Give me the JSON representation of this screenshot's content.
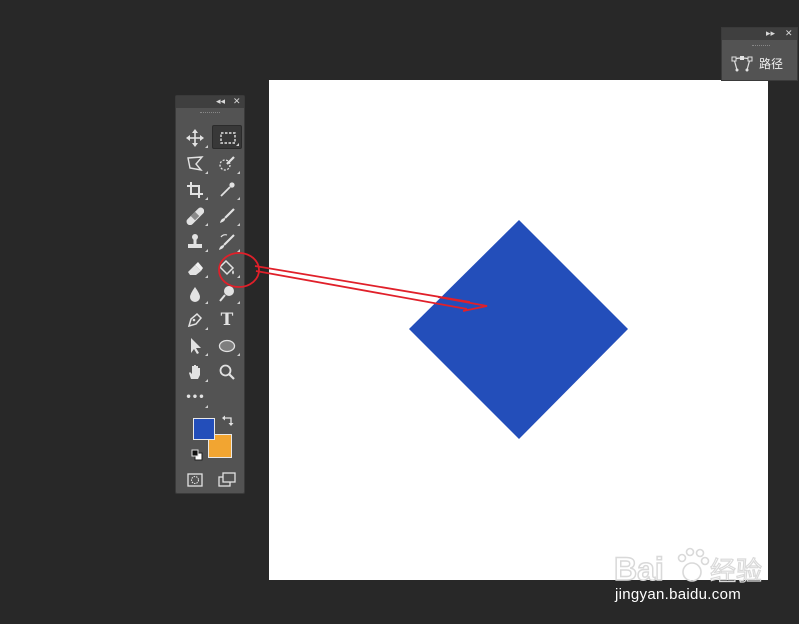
{
  "colors": {
    "workspace": "#282828",
    "canvas": "#ffffff",
    "diamond": "#234eba",
    "foreground": "#234eba",
    "background": "#f2a531",
    "annotation": "#e0202a"
  },
  "tools_panel": {
    "collapse_glyph": "◂◂",
    "close_glyph": "✕",
    "tools": [
      {
        "name": "move-tool",
        "icon": "move-icon"
      },
      {
        "name": "rectangular-marquee-tool",
        "icon": "marquee-icon",
        "active": true
      },
      {
        "name": "lasso-tool",
        "icon": "lasso-icon"
      },
      {
        "name": "quick-selection-tool",
        "icon": "quick-selection-icon"
      },
      {
        "name": "crop-tool",
        "icon": "crop-icon"
      },
      {
        "name": "eyedropper-tool",
        "icon": "eyedropper-icon"
      },
      {
        "name": "healing-brush-tool",
        "icon": "bandage-icon"
      },
      {
        "name": "brush-tool",
        "icon": "brush-icon"
      },
      {
        "name": "clone-stamp-tool",
        "icon": "stamp-icon"
      },
      {
        "name": "history-brush-tool",
        "icon": "history-brush-icon"
      },
      {
        "name": "eraser-tool",
        "icon": "eraser-icon"
      },
      {
        "name": "paint-bucket-tool",
        "icon": "paint-bucket-icon",
        "highlighted": true
      },
      {
        "name": "blur-tool",
        "icon": "drop-icon"
      },
      {
        "name": "dodge-tool",
        "icon": "dodge-icon"
      },
      {
        "name": "pen-tool",
        "icon": "pen-icon"
      },
      {
        "name": "type-tool",
        "icon": "type-icon",
        "label": "T"
      },
      {
        "name": "path-selection-tool",
        "icon": "arrow-icon"
      },
      {
        "name": "ellipse-tool",
        "icon": "ellipse-icon"
      },
      {
        "name": "hand-tool",
        "icon": "hand-icon"
      },
      {
        "name": "zoom-tool",
        "icon": "magnifier-icon"
      },
      {
        "name": "edit-toolbar",
        "icon": "more-icon",
        "label": "•••"
      }
    ]
  },
  "paths_panel": {
    "expand_glyph": "▸▸",
    "close_glyph": "✕",
    "label": "路径",
    "icon": "paths-icon"
  },
  "watermark": {
    "logo_text": "Bai",
    "logo_cn": "经验",
    "url": "jingyan.baidu.com"
  }
}
